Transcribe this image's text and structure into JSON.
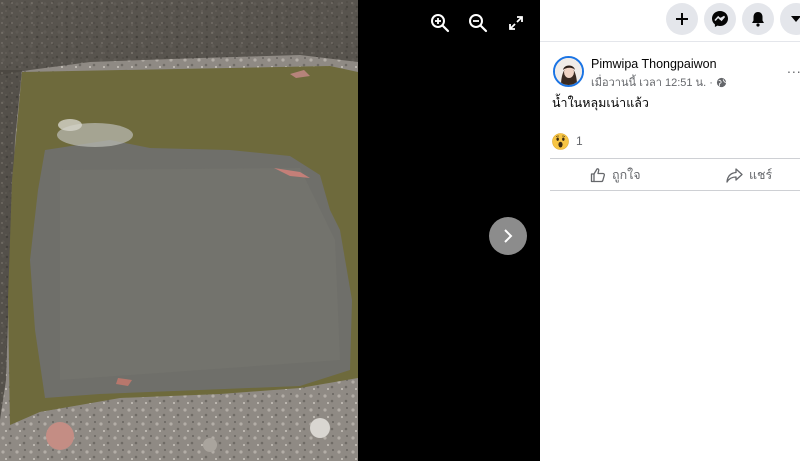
{
  "viewer": {
    "icons": {
      "zoom_in": "zoom-in-icon",
      "zoom_out": "zoom-out-icon",
      "fullscreen": "fullscreen-icon",
      "next": "chevron-right-icon"
    },
    "photo_description": "puddle of greenish water in a dug hole"
  },
  "topbar": {
    "icons": [
      "plus-icon",
      "messenger-icon",
      "bell-icon",
      "caret-down-icon"
    ]
  },
  "post": {
    "author": "Pimwipa Thongpaiwon",
    "timestamp": "เมื่อวานนี้ เวลา 12:51 น. ·",
    "privacy_icon": "globe-icon",
    "more_label": "...",
    "text": "น้ำในหลุมเน่าแล้ว",
    "reaction_icon": "wow-emoji-icon",
    "reaction_count": "1",
    "actions": {
      "like_label": "ถูกใจ",
      "share_label": "แชร์"
    }
  },
  "colors": {
    "viewer_bg": "#000000",
    "panel_bg": "#ffffff",
    "button_bg": "#e4e6eb",
    "text_primary": "#050505",
    "text_secondary": "#65676b",
    "accent": "#1b74e4"
  }
}
